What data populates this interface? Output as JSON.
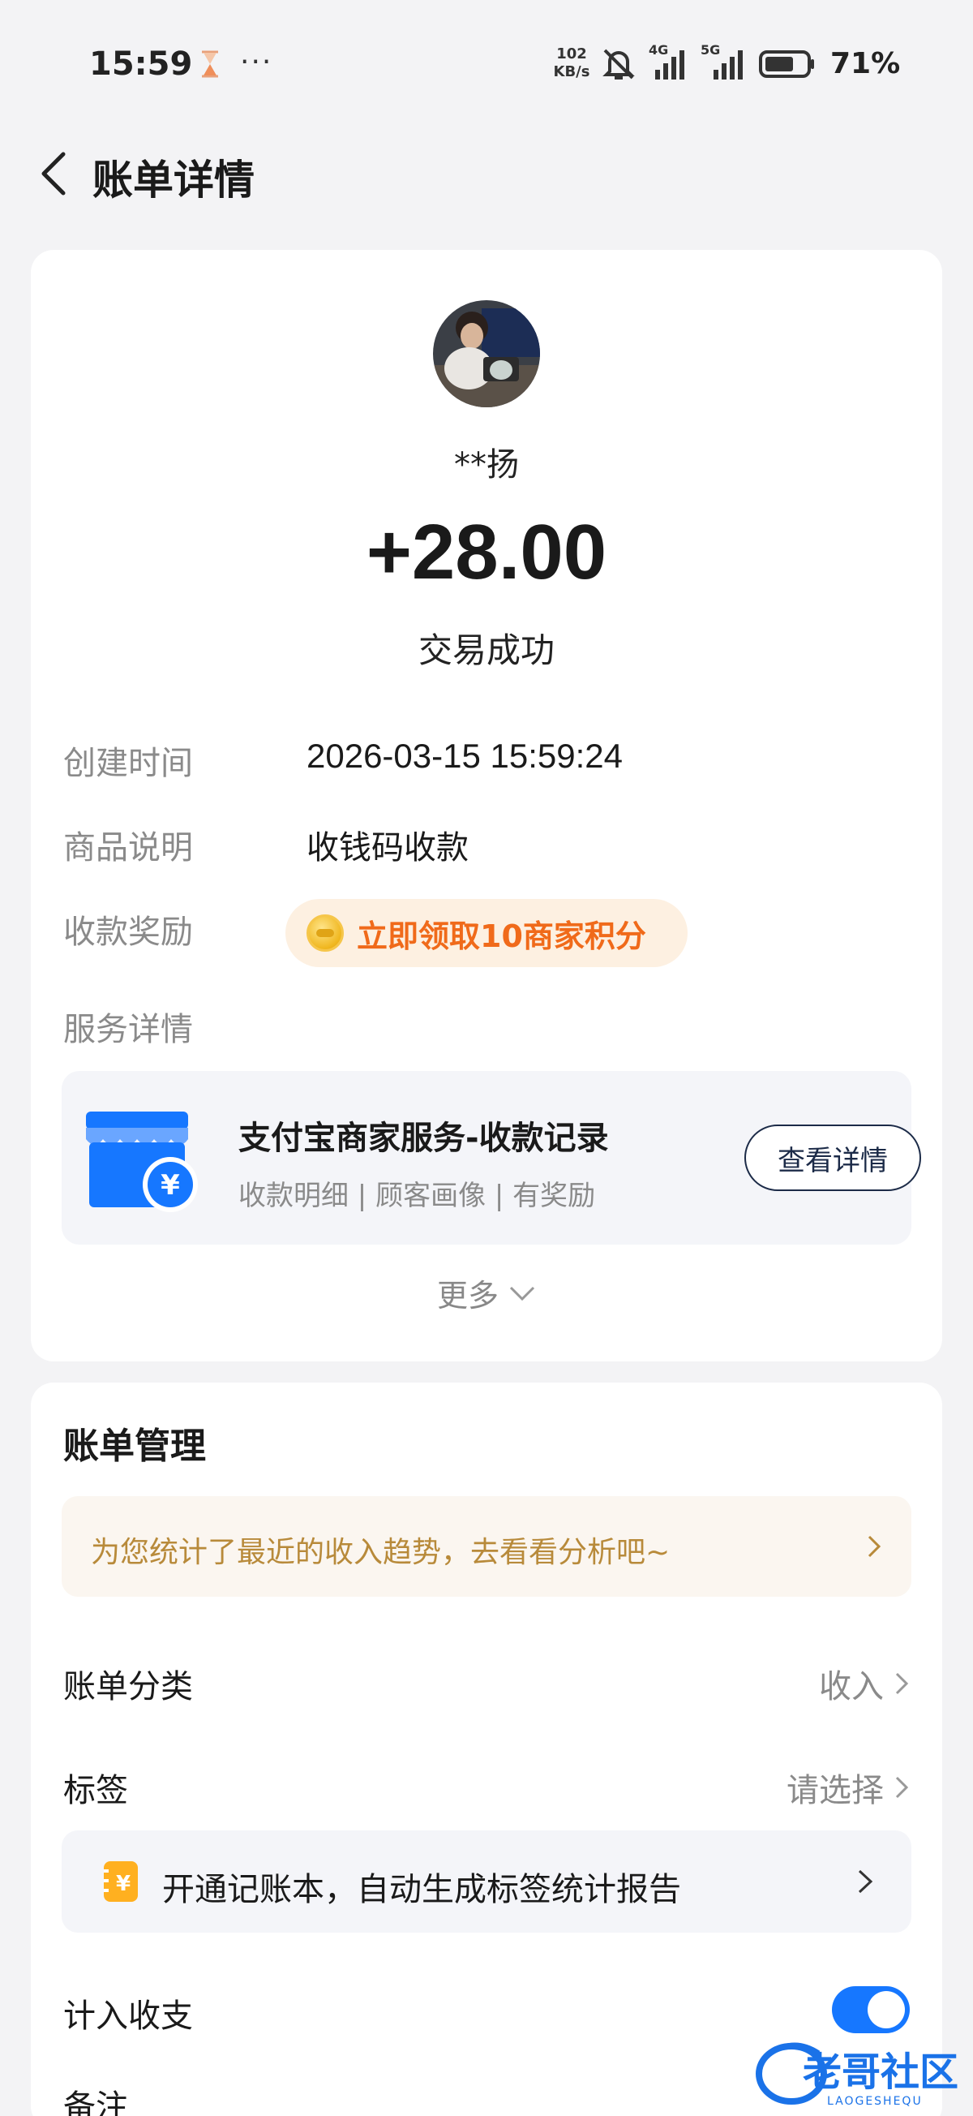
{
  "status_bar": {
    "time": "15:59",
    "more": "···",
    "net_speed_value": "102",
    "net_speed_unit": "KB/s",
    "sim1": "4G",
    "sim2": "5G",
    "battery": "71%"
  },
  "header": {
    "title": "账单详情"
  },
  "transaction": {
    "name": "**扬",
    "amount": "+28.00",
    "status": "交易成功",
    "created_label": "创建时间",
    "created_value": "2026-03-15 15:59:24",
    "desc_label": "商品说明",
    "desc_value": "收钱码收款",
    "reward_label": "收款奖励",
    "reward_text": "立即领取10商家积分",
    "service_label": "服务详情",
    "service_title": "支付宝商家服务-收款记录",
    "service_sub": "收款明细 | 顾客画像 | 有奖励",
    "service_button": "查看详情",
    "more": "更多"
  },
  "management": {
    "title": "账单管理",
    "trend_text": "为您统计了最近的收入趋势，去看看分析吧~",
    "category_label": "账单分类",
    "category_value": "收入",
    "tag_label": "标签",
    "tag_value": "请选择",
    "ledger_text": "开通记账本，自动生成标签统计报告",
    "count_label": "计入收支",
    "count_enabled": true,
    "note_label": "备注"
  },
  "watermark": {
    "text": "老哥社区",
    "sub": "LAOGESHEQU"
  },
  "colors": {
    "accent": "#1677ff",
    "reward": "#f06a1a",
    "trend": "#b88a3a"
  }
}
